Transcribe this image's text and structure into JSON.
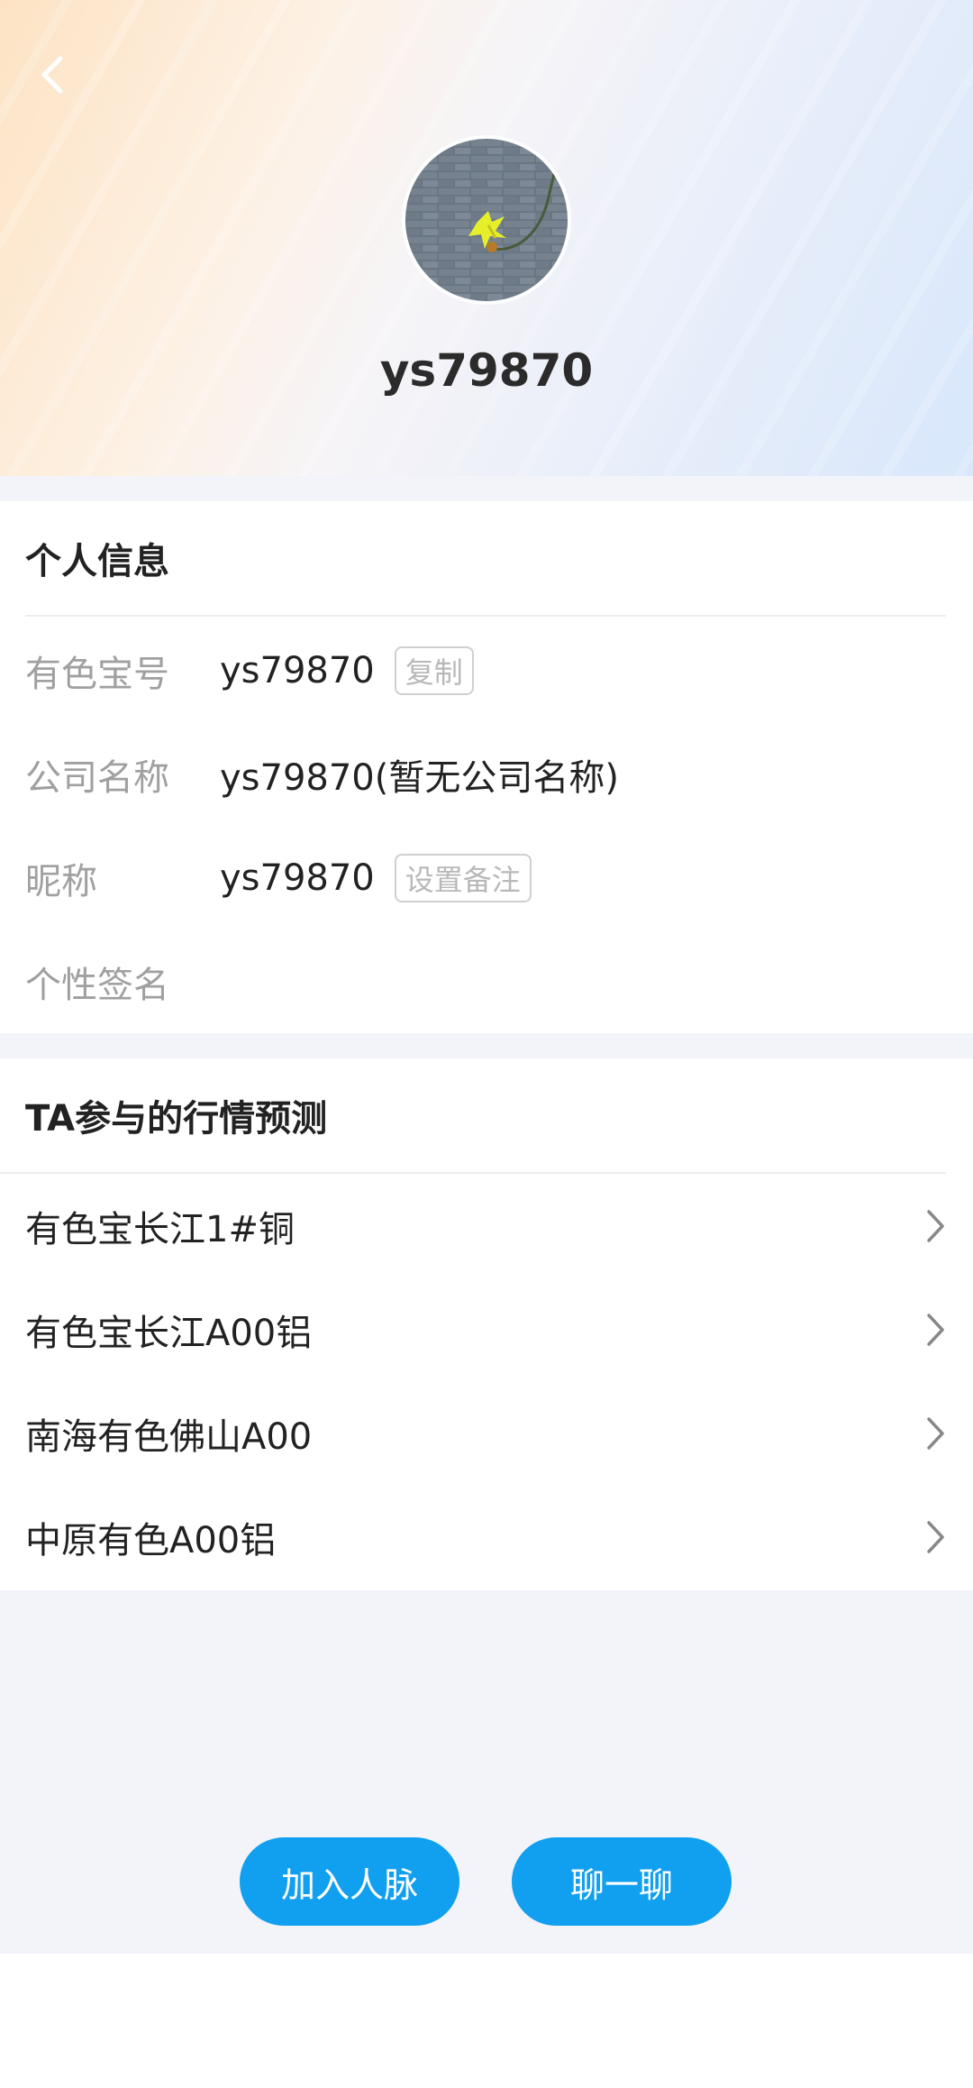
{
  "header": {
    "back_icon": "chevron-left-icon",
    "username": "ys79870"
  },
  "personal_info": {
    "title": "个人信息",
    "rows": [
      {
        "label": "有色宝号",
        "value": "ys79870",
        "action": "复制"
      },
      {
        "label": "公司名称",
        "value": "ys79870(暂无公司名称)"
      },
      {
        "label": "昵称",
        "value": "ys79870",
        "action": "设置备注"
      },
      {
        "label": "个性签名",
        "value": ""
      }
    ]
  },
  "predictions": {
    "title": "TA参与的行情预测",
    "items": [
      {
        "label": "有色宝长江1#铜"
      },
      {
        "label": "有色宝长江A00铝"
      },
      {
        "label": "南海有色佛山A00"
      },
      {
        "label": "中原有色A00铝"
      }
    ]
  },
  "actions": {
    "add_contact": "加入人脉",
    "chat": "聊一聊"
  },
  "colors": {
    "accent": "#119ff0",
    "label_gray": "#a0a0a0"
  }
}
